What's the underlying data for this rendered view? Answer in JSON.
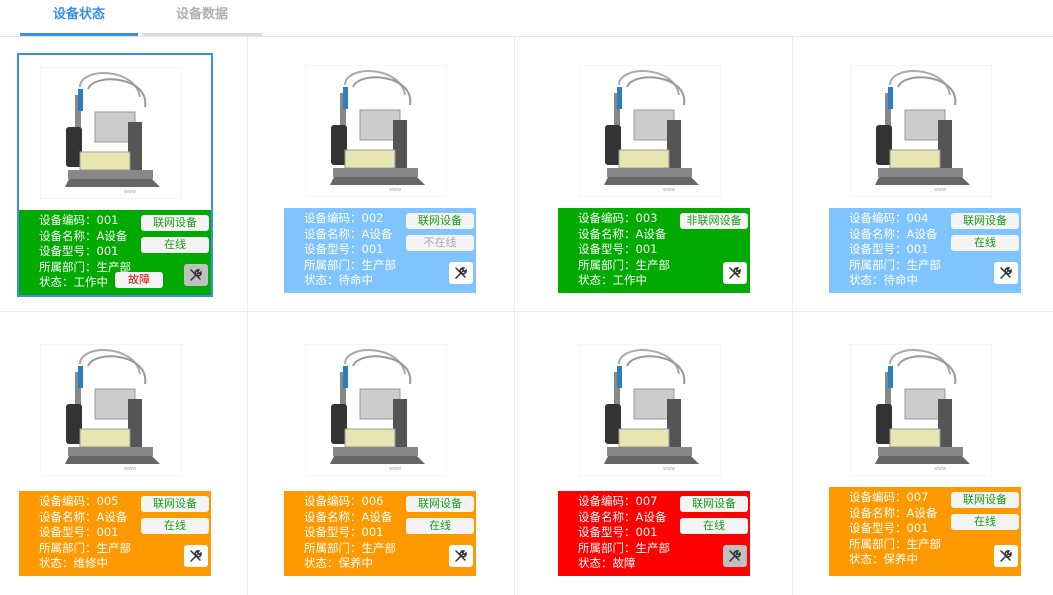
{
  "tabs": {
    "status": "设备状态",
    "data": "设备数据"
  },
  "labels": {
    "code": "设备编码：",
    "name": "设备名称：",
    "model": "设备型号：",
    "dept": "所属部门：",
    "state": "状态："
  },
  "devices": [
    {
      "code": "001",
      "name": "A设备",
      "model": "001",
      "dept": "生产部",
      "state": "工作中",
      "badge1": "联网设备",
      "badge2": "在线",
      "fault_badge": "故障",
      "color": "#00aa00"
    },
    {
      "code": "002",
      "name": "A设备",
      "model": "001",
      "dept": "生产部",
      "state": "待命中",
      "badge1": "联网设备",
      "badge2": "不在线",
      "color": "#7fc3ff"
    },
    {
      "code": "003",
      "name": "A设备",
      "model": "001",
      "dept": "生产部",
      "state": "工作中",
      "badge1": "非联网设备",
      "color": "#00aa00"
    },
    {
      "code": "004",
      "name": "A设备",
      "model": "001",
      "dept": "生产部",
      "state": "待命中",
      "badge1": "联网设备",
      "badge2": "在线",
      "color": "#7fc3ff"
    },
    {
      "code": "005",
      "name": "A设备",
      "model": "001",
      "dept": "生产部",
      "state": "维修中",
      "badge1": "联网设备",
      "badge2": "在线",
      "color": "#ff9900"
    },
    {
      "code": "006",
      "name": "A设备",
      "model": "001",
      "dept": "生产部",
      "state": "保养中",
      "badge1": "联网设备",
      "badge2": "在线",
      "color": "#ff9900"
    },
    {
      "code": "007",
      "name": "A设备",
      "model": "001",
      "dept": "生产部",
      "state": "故障",
      "badge1": "联网设备",
      "badge2": "在线",
      "color": "#ff0000"
    },
    {
      "code": "007",
      "name": "A设备",
      "model": "001",
      "dept": "生产部",
      "state": "保养中",
      "badge1": "联网设备",
      "badge2": "在线",
      "color": "#ff9900"
    }
  ]
}
